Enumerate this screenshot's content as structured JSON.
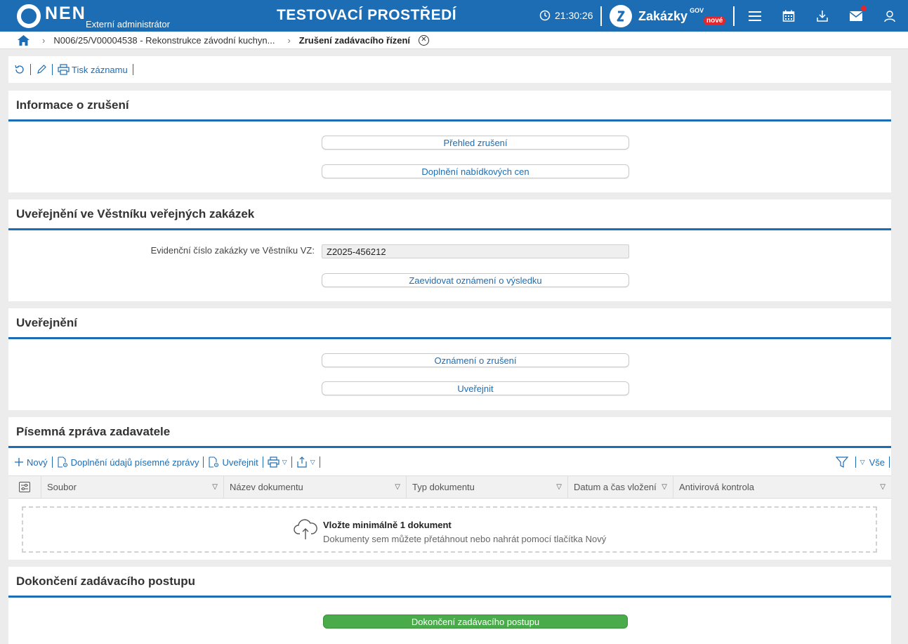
{
  "header": {
    "logo_text": "NEN",
    "logo_sub": "Externí administrátor",
    "env_title": "TESTOVACÍ PROSTŘEDÍ",
    "time": "21:30:26",
    "zakazky_label": "Zakázky",
    "zakazky_gov": "GOV",
    "zakazky_badge": "nové",
    "icons": [
      "clock-icon",
      "menu-icon",
      "calendar-icon",
      "download-icon",
      "mail-icon",
      "user-icon"
    ]
  },
  "breadcrumb": {
    "item1": "N006/25/V00004538 - Rekonstrukce závodní kuchyn...",
    "current": "Zrušení zadávacího řízení"
  },
  "toolbar": {
    "print_label": "Tisk záznamu"
  },
  "info_section": {
    "title": "Informace o zrušení",
    "btn_prehled": "Přehled zrušení",
    "btn_doplneni": "Doplnění nabídkových cen"
  },
  "vestnik_section": {
    "title": "Uveřejnění ve Věstníku veřejných zakázek",
    "field_label": "Evidenční číslo zakázky ve Věstníku VZ:",
    "field_value": "Z2025-456212",
    "btn_zaevidovat": "Zaevidovat oznámení o výsledku"
  },
  "uverejneni_section": {
    "title": "Uveřejnění",
    "btn_oznameni": "Oznámení o zrušení",
    "btn_uverejnit": "Uveřejnit"
  },
  "zprava_section": {
    "title": "Písemná zpráva zadavatele",
    "tb_novy": "Nový",
    "tb_doplneni": "Doplnění údajů písemné zprávy",
    "tb_uverejnit": "Uveřejnit",
    "filter_label": "Vše",
    "columns": [
      "Soubor",
      "Název dokumentu",
      "Typ dokumentu",
      "Datum a čas vložení",
      "Antivirová kontrola"
    ],
    "dropzone_title": "Vložte minimálně 1 dokument",
    "dropzone_sub": "Dokumenty sem můžete přetáhnout nebo nahrát pomocí tlačítka Nový"
  },
  "dokonceni_section": {
    "title": "Dokončení zadávacího postupu",
    "btn_dokonceni": "Dokončení zadávacího postupu"
  },
  "colors": {
    "brand_blue": "#1d6db4",
    "green": "#4aab4a",
    "badge_red": "#e4262c"
  }
}
